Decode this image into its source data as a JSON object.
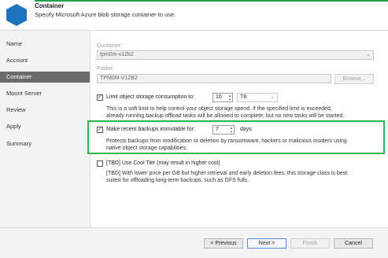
{
  "header": {
    "title": "Container",
    "subtitle": "Specify Microsoft Azure blob storage container to use."
  },
  "sidebar": {
    "items": [
      {
        "label": "Name",
        "active": false
      },
      {
        "label": "Account",
        "active": false
      },
      {
        "label": "Container",
        "active": true
      },
      {
        "label": "Mount Server",
        "active": false
      },
      {
        "label": "Review",
        "active": false
      },
      {
        "label": "Apply",
        "active": false
      },
      {
        "label": "Summary",
        "active": false
      }
    ]
  },
  "form": {
    "container_label": "Container:",
    "container_value": "tpm0m-v12b2",
    "folder_label": "Folder:",
    "folder_value": "TPM0M-V12B2",
    "browse_label": "Browse...",
    "limit": {
      "checked": true,
      "label": "Limit object storage consumption to:",
      "value": "10",
      "unit": "TB",
      "desc_line1": "This is a soft limit to help control your object storage spend. If the specified limit is exceeded,",
      "desc_line2": "already running backup offload tasks will be allowed to complete, but no new tasks will be started."
    },
    "immutable": {
      "checked": true,
      "label": "Make recent backups immutable for:",
      "value": "7",
      "unit": "days",
      "desc_line1": "Protects backups from modification or deletion by ransomware, hackers or malicious insiders using",
      "desc_line2": "native object storage capabilities."
    },
    "cool_tier": {
      "checked": false,
      "label": "[TBD] Use Cool Tier (may result in higher cost)",
      "desc_line1": "[TBD] With lower price per GB but higher retrieval and early deletion fees, this storage class is best",
      "desc_line2": "suited for offloading long-term backups, such as GFS fulls."
    }
  },
  "footer": {
    "previous_label": "< Previous",
    "next_label": "Next >",
    "finish_label": "Finish",
    "cancel_label": "Cancel"
  },
  "colors": {
    "highlight": "#2db84b",
    "logo": "#1e73be",
    "active_nav": "#6b6b6b"
  }
}
